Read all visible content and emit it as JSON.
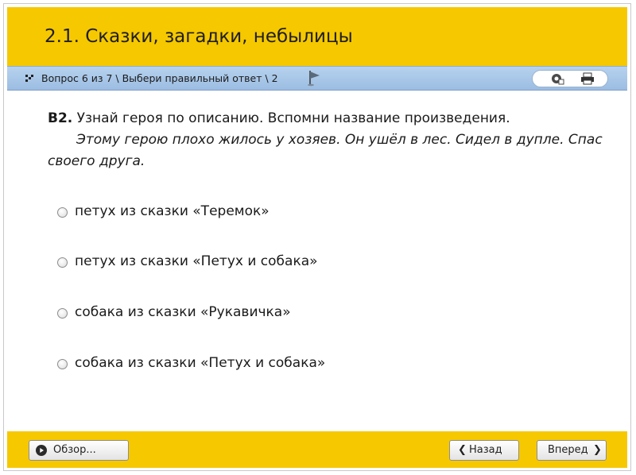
{
  "header": {
    "title": "2.1. Сказки, загадки, небылицы"
  },
  "navbar": {
    "breadcrumb": "Вопрос 6 из 7 \\ Выбери правильный ответ \\ 2",
    "icons": [
      "grid-bullet-icon",
      "flag-icon",
      "settings-icon",
      "print-icon"
    ]
  },
  "question": {
    "number": "В2.",
    "prompt": "Узнай героя по описанию. Вспомни название произведения.",
    "description": "Этому герою плохо жилось у хозяев. Он ушёл в лес. Сидел в дупле. Спас своего друга."
  },
  "options": [
    "петух из сказки «Теремок»",
    "петух из сказки «Петух и собака»",
    "собака из сказки «Рукавичка»",
    "собака из сказки «Петух и собака»"
  ],
  "footer": {
    "overview_label": "Обзор...",
    "back_label": "Назад",
    "next_label": "Вперед"
  },
  "colors": {
    "header": "#f6c800",
    "navbar": "#a9c8e9",
    "footer": "#f6c800"
  }
}
